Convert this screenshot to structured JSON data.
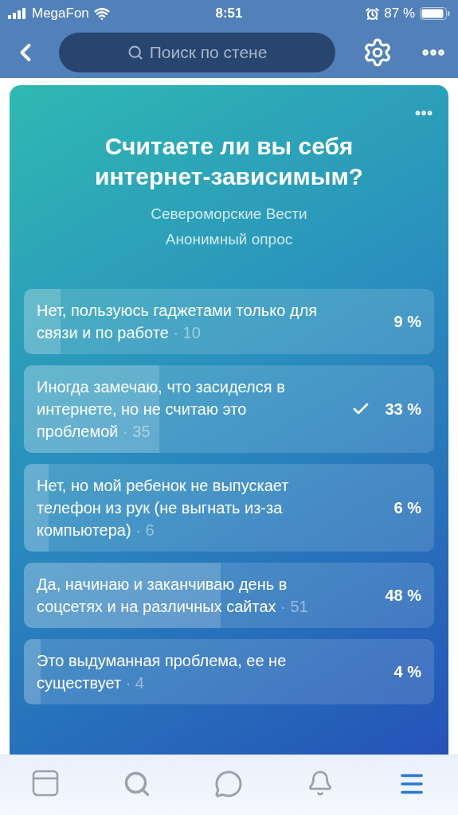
{
  "status_bar": {
    "carrier": "MegaFon",
    "time": "8:51",
    "battery": "87 %"
  },
  "nav": {
    "search": {
      "placeholder": "Поиск по стене"
    }
  },
  "poll": {
    "title": "Считаете ли вы себя интернет-зависимым?",
    "author": "Североморские Вести",
    "type": "Анонимный опрос",
    "options": [
      {
        "text": "Нет, пользуюсь гаджетами только для связи и по работе",
        "votes": "· 10",
        "percent": "9 %",
        "level": 0.09,
        "checked": false
      },
      {
        "text": "Иногда замечаю, что засиделся в интернете, но не считаю это проблемой",
        "votes": "· 35",
        "percent": "33 %",
        "level": 0.33,
        "checked": true
      },
      {
        "text": "Нет, но мой ребенок не выпускает телефон из рук (не выгнать из-за компьютера)",
        "votes": "· 6",
        "percent": "6 %",
        "level": 0.06,
        "checked": false
      },
      {
        "text": "Да, начинаю и заканчиваю день в соцсетях и на различных сайтах",
        "votes": "· 51",
        "percent": "48 %",
        "level": 0.48,
        "checked": false
      },
      {
        "text": "Это выдуманная проблема, ее не существует",
        "votes": "· 4",
        "percent": "4 %",
        "level": 0.04,
        "checked": false
      }
    ]
  },
  "tab_bar": [
    {
      "kind": "feed",
      "selected": false
    },
    {
      "kind": "search",
      "selected": false
    },
    {
      "kind": "messages",
      "selected": false
    },
    {
      "kind": "notifications",
      "selected": false
    },
    {
      "kind": "menu",
      "selected": true
    }
  ]
}
